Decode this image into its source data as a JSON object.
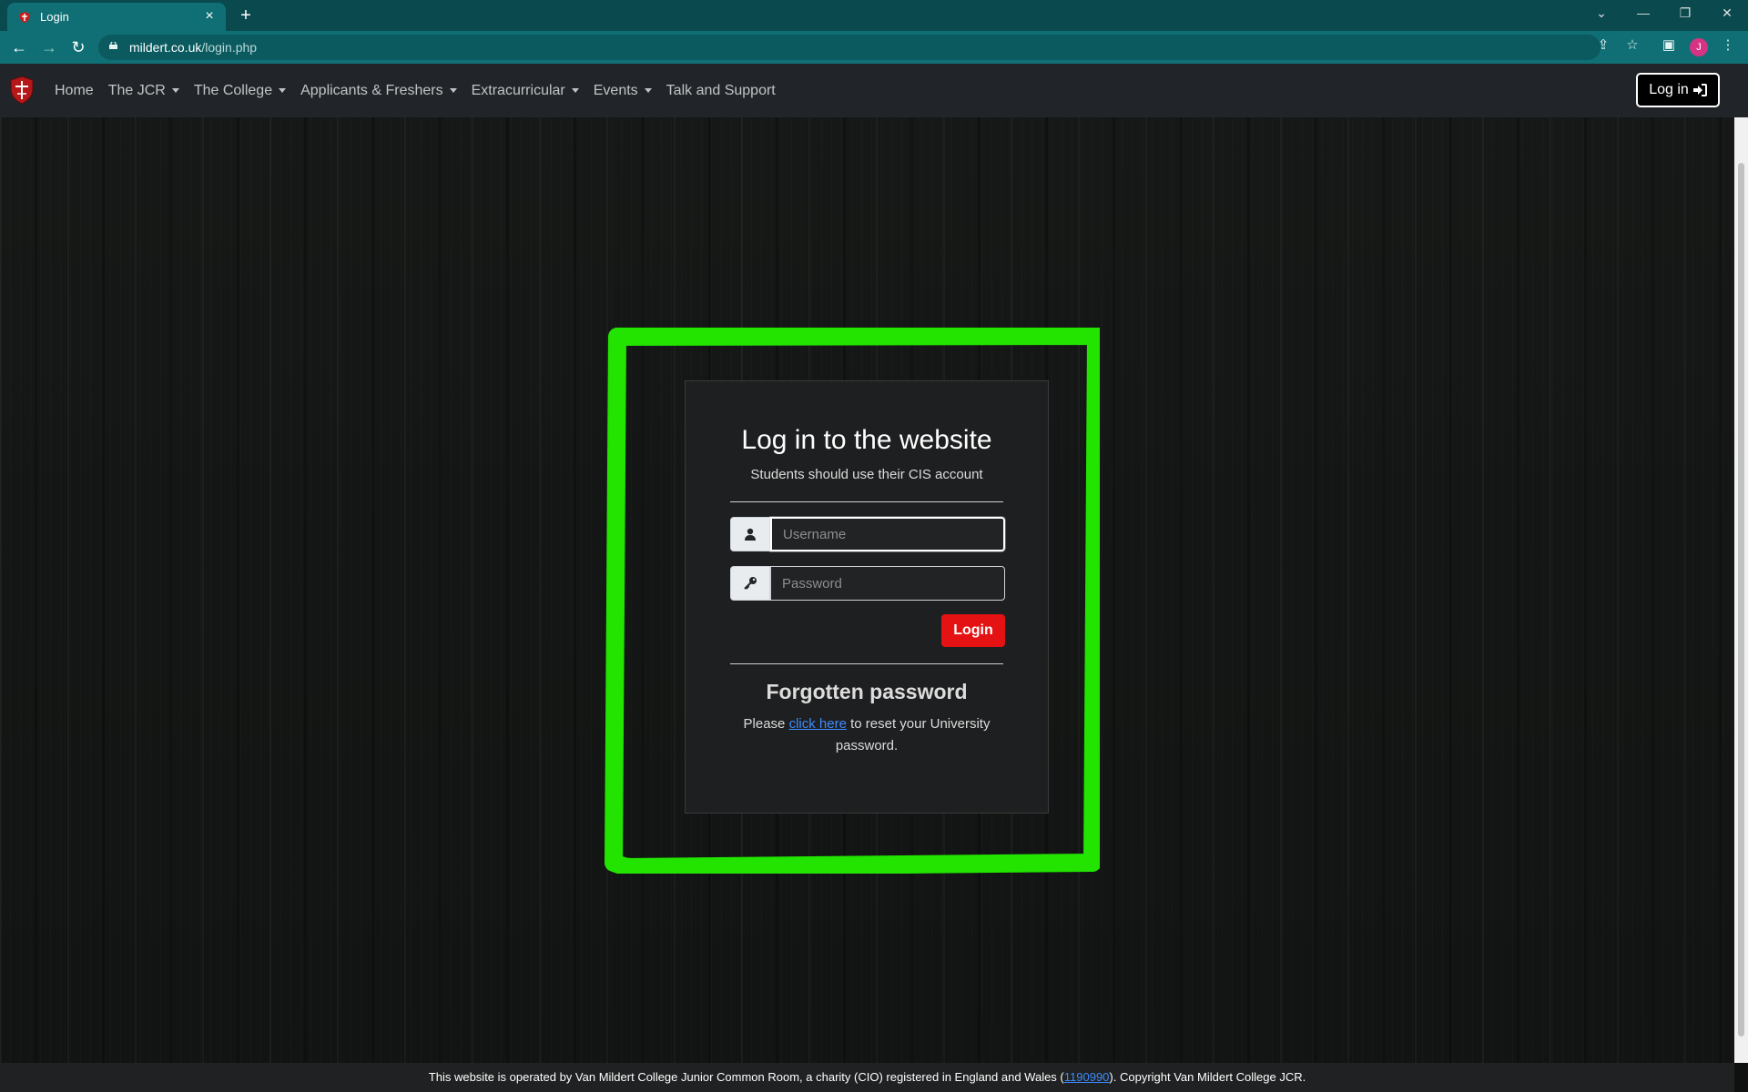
{
  "browser": {
    "tab_title": "Login",
    "new_tab_label": "+",
    "url_domain": "mildert.co.uk",
    "url_path": "/login.php",
    "profile_initial": "J",
    "window_controls": [
      "⌄",
      "—",
      "❐",
      "✕"
    ]
  },
  "nav": {
    "items": [
      {
        "label": "Home",
        "dropdown": false
      },
      {
        "label": "The JCR",
        "dropdown": true
      },
      {
        "label": "The College",
        "dropdown": true
      },
      {
        "label": "Applicants & Freshers",
        "dropdown": true
      },
      {
        "label": "Extracurricular",
        "dropdown": true
      },
      {
        "label": "Events",
        "dropdown": true
      },
      {
        "label": "Talk and Support",
        "dropdown": false
      }
    ],
    "login_label": "Log in"
  },
  "login": {
    "title": "Log in to the website",
    "subtitle": "Students should use their CIS account",
    "username_placeholder": "Username",
    "password_placeholder": "Password",
    "button_label": "Login",
    "forgot_heading": "Forgotten password",
    "reset_prefix": "Please ",
    "reset_link": "click here",
    "reset_suffix": " to reset your University password."
  },
  "footer": {
    "prefix": "This website is operated by Van Mildert College Junior Common Room, a charity (CIO) registered in England and Wales (",
    "charity_number": "1190990",
    "suffix": "). Copyright Van Mildert College JCR."
  },
  "colors": {
    "browser_frame": "#0a4a4f",
    "browser_toolbar": "#0f6f74",
    "nav_bg": "#212529",
    "login_button": "#e41212",
    "highlight": "#22e400",
    "link": "#3d8bff"
  },
  "icons": {
    "user": "user-icon",
    "key": "key-icon",
    "sign_in": "sign-in-icon",
    "logo": "college-crest-logo"
  }
}
